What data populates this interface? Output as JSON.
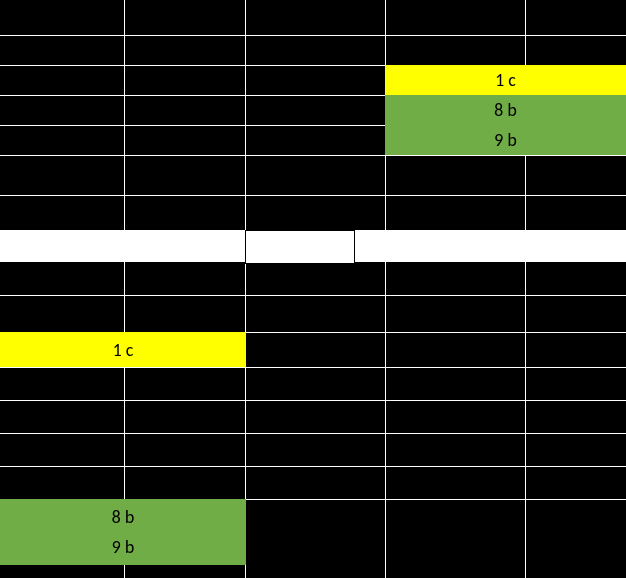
{
  "blocks": {
    "top_yellow": "1 c",
    "top_green1": "8 b",
    "top_green2": "9 b",
    "mid_yellow": "1 c",
    "bot_green1": "8 b",
    "bot_green2": "9 b"
  }
}
